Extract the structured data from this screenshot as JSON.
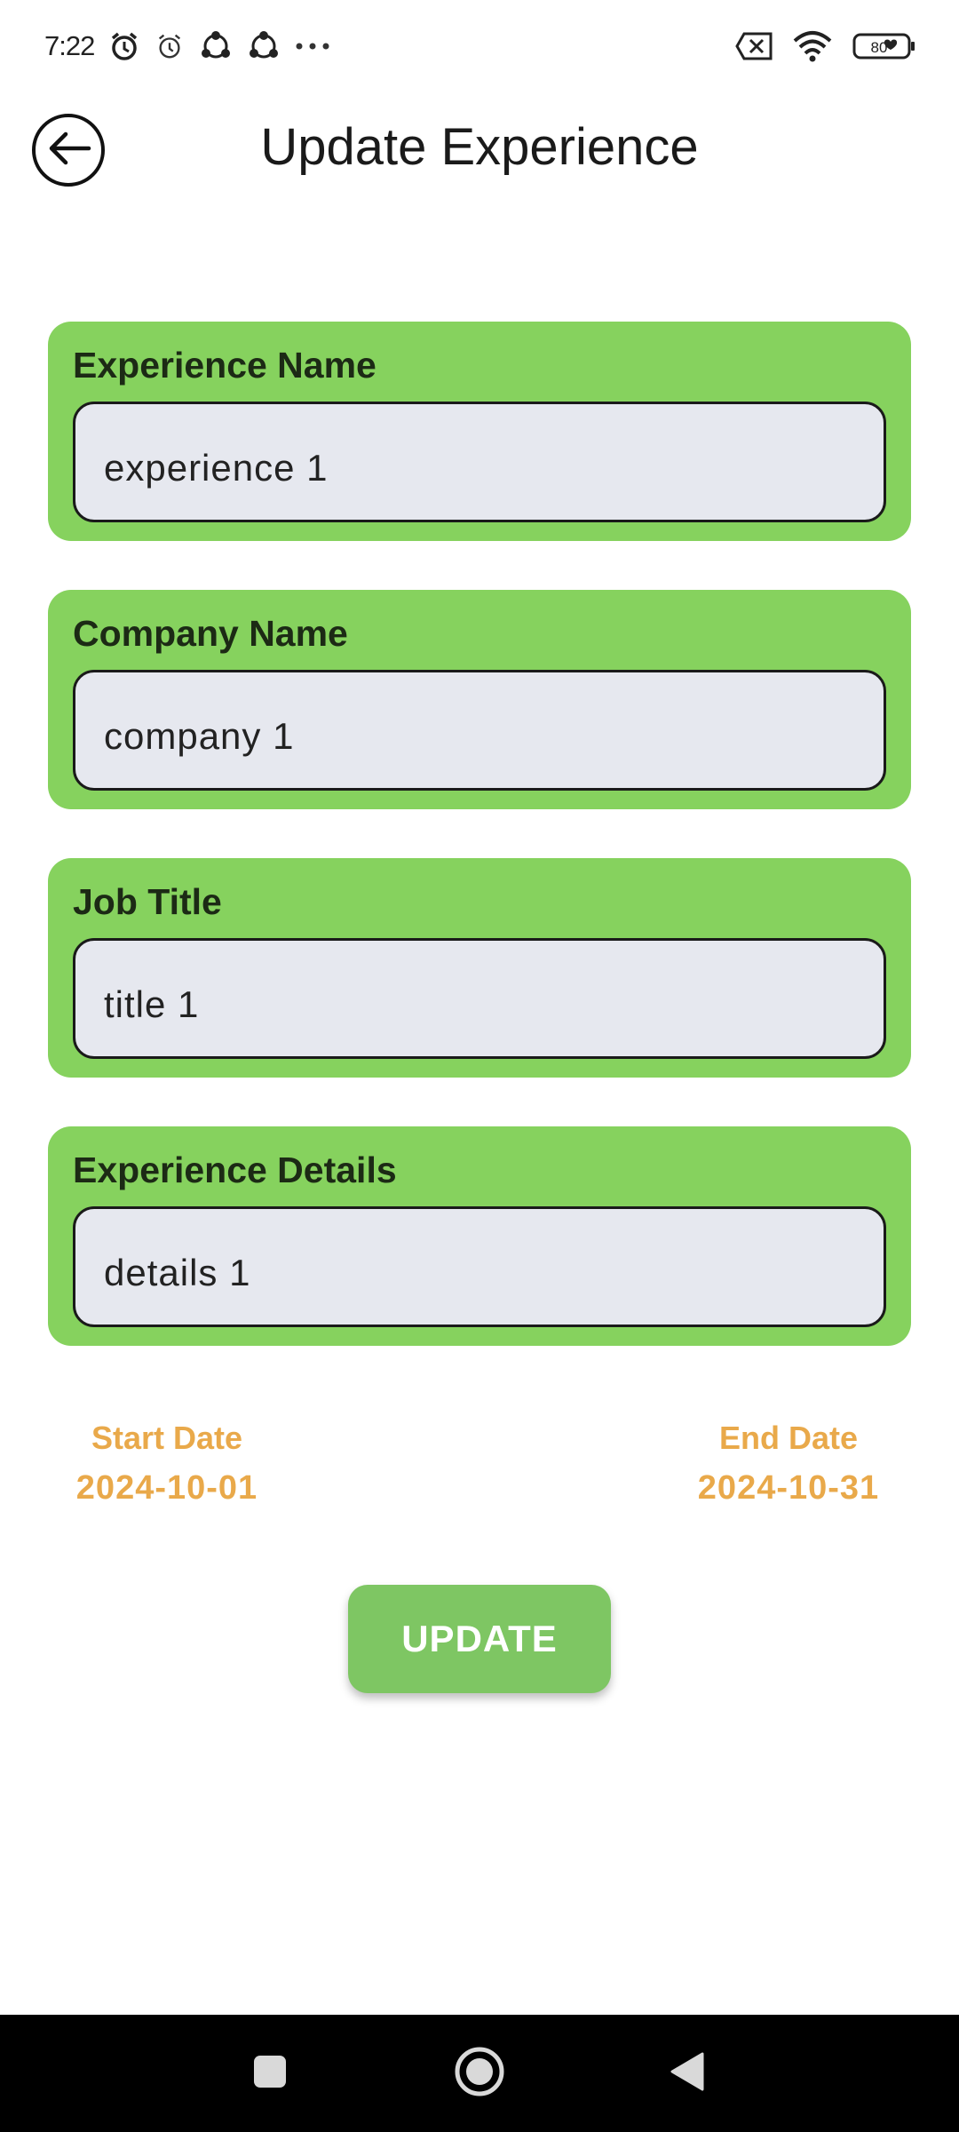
{
  "status_bar": {
    "time": "7:22",
    "icons": [
      "alarm-icon",
      "alarm-icon",
      "share-icon",
      "share-icon",
      "more-dots-icon",
      "no-sim-icon",
      "wifi-icon",
      "battery-icon"
    ],
    "battery_level": "80"
  },
  "app_bar": {
    "title": "Update Experience"
  },
  "form": {
    "experience_name": {
      "label": "Experience Name",
      "value": "experience 1"
    },
    "company_name": {
      "label": "Company Name",
      "value": "company 1"
    },
    "job_title": {
      "label": "Job Title",
      "value": "title 1"
    },
    "experience_details": {
      "label": "Experience Details",
      "value": "details 1"
    }
  },
  "dates": {
    "start_label": "Start Date",
    "start_value": "2024-10-01",
    "end_label": "End Date",
    "end_value": "2024-10-31"
  },
  "update_button": {
    "label": "UPDATE"
  },
  "colors": {
    "card_green": "#86d25e",
    "field_bg": "#e6e8ef",
    "date_orange": "#e9a94a",
    "button_green": "#7ec663"
  }
}
